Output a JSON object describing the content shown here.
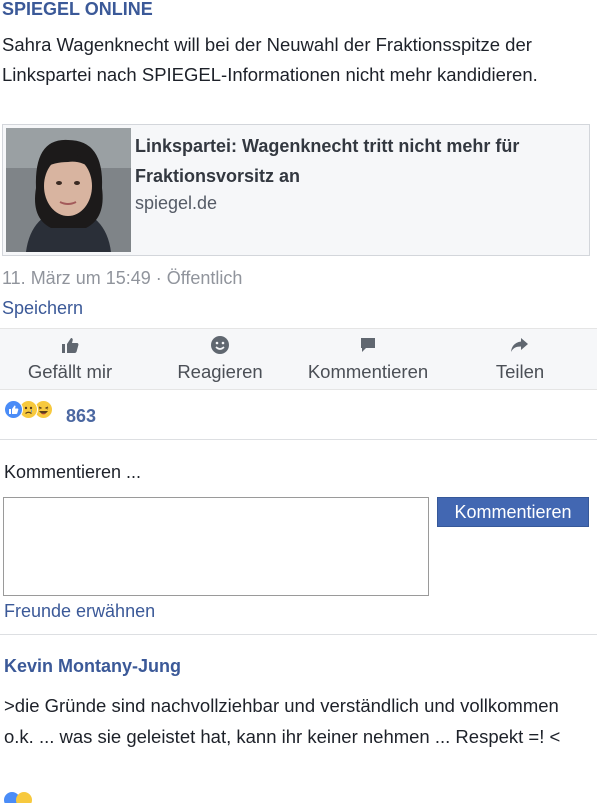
{
  "post": {
    "source": "SPIEGEL ONLINE",
    "text": "Sahra Wagenknecht will bei der Neuwahl der Fraktionsspitze der Linkspartei nach SPIEGEL-Informationen nicht  mehr kandidieren.",
    "link": {
      "title": "Linkspartei: Wagenknecht tritt nicht mehr für Fraktionsvorsitz an",
      "domain": "spiegel.de"
    },
    "meta": "11. März um 15:49 · Öffentlich",
    "save_label": "Speichern"
  },
  "actions": {
    "like": "Gefällt mir",
    "react": "Reagieren",
    "comment": "Kommentieren",
    "share": "Teilen"
  },
  "reactions": {
    "count": "863",
    "icons": [
      "like-icon",
      "sad-icon",
      "haha-icon"
    ],
    "colors": {
      "like": "#4a8cf7",
      "emoji": "#f7c93e"
    }
  },
  "comment_form": {
    "label": "Kommentieren ...",
    "value": "",
    "submit_label": "Kommentieren",
    "mention_link": "Freunde erwähnen"
  },
  "comments": [
    {
      "author": "Kevin Montany-Jung",
      "text": ">die Gründe sind nachvollziehbar und verständlich und vollkommen o.k. ... was sie geleistet hat, kann ihr keiner nehmen ... Respekt =! <"
    }
  ],
  "colors": {
    "brand": "#3b5998",
    "button": "#4267b2"
  }
}
